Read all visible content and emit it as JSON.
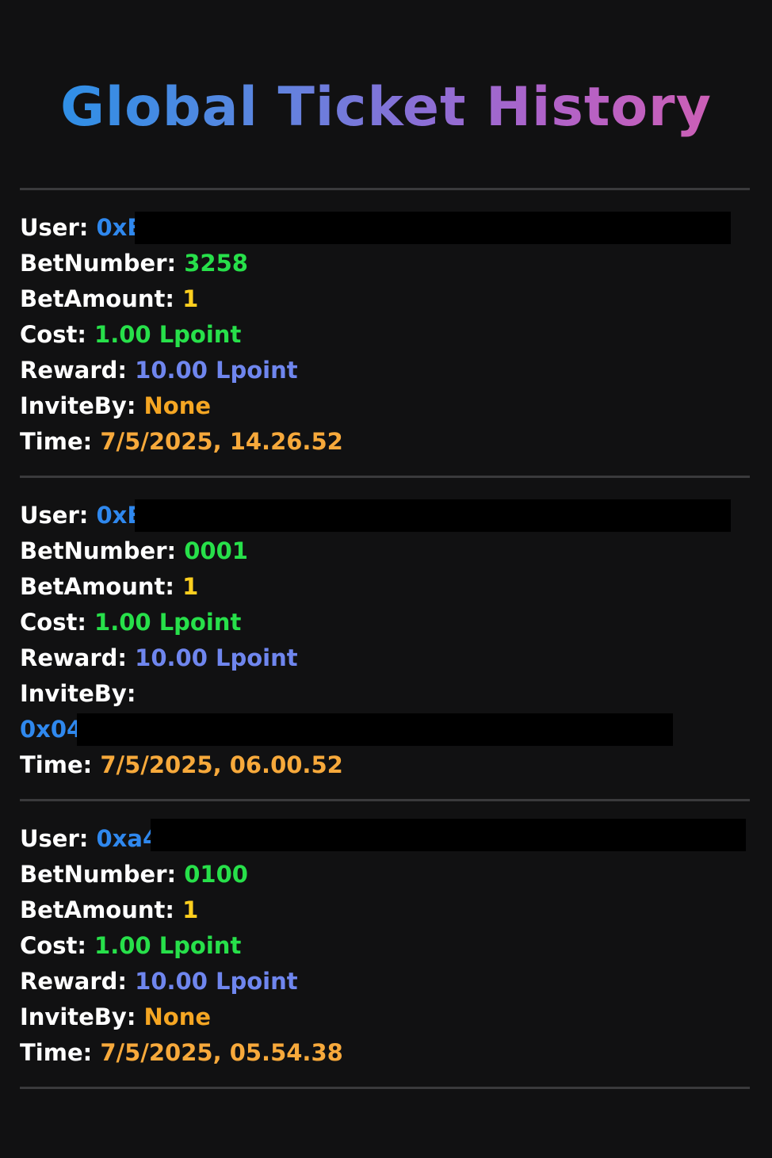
{
  "page": {
    "title": "Global Ticket History"
  },
  "labels": {
    "user": "User:",
    "bet_number": "BetNumber:",
    "bet_amount": "BetAmount:",
    "cost": "Cost:",
    "reward": "Reward:",
    "invite_by": "InviteBy:",
    "time": "Time:"
  },
  "tickets": [
    {
      "user": "0xE",
      "bet_number": "3258",
      "bet_amount": "1",
      "cost": "1.00 Lpoint",
      "reward": "10.00 Lpoint",
      "invite_by": "None",
      "time": "7/5/2025, 14.26.52"
    },
    {
      "user": "0xE",
      "bet_number": "0001",
      "bet_amount": "1",
      "cost": "1.00 Lpoint",
      "reward": "10.00 Lpoint",
      "invite_by": "0x04",
      "time": "7/5/2025, 06.00.52"
    },
    {
      "user": "0xa4",
      "bet_number": "0100",
      "bet_amount": "1",
      "cost": "1.00 Lpoint",
      "reward": "10.00 Lpoint",
      "invite_by": "None",
      "time": "7/5/2025, 05.54.38"
    }
  ],
  "colors": {
    "background": "#111112",
    "user_value": "#2f88ee",
    "bet_number_value": "#27e04a",
    "bet_amount_value": "#ffcf1f",
    "cost_value": "#27e04a",
    "reward_value": "#6f86ee",
    "invite_none": "#f5a623",
    "time_value": "#f7a93b",
    "divider": "#3a3a3c"
  }
}
